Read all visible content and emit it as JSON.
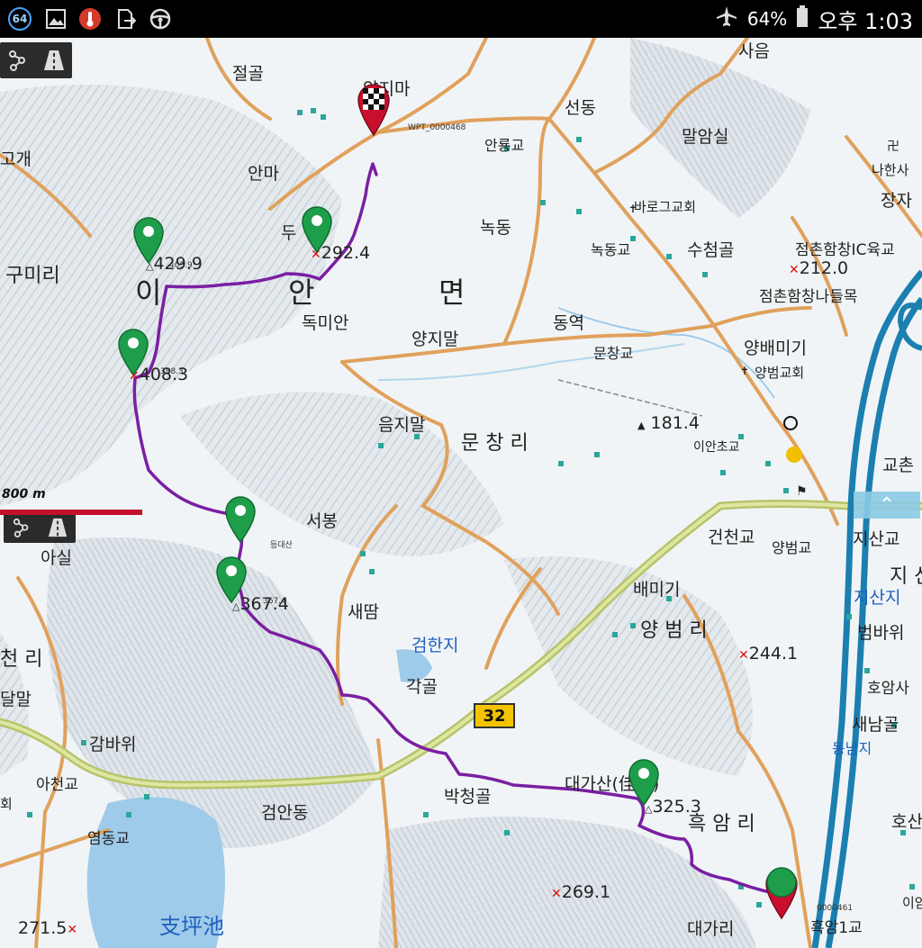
{
  "status_bar": {
    "notification_badge": "64",
    "battery_text": "64%",
    "clock": "오후 1:03",
    "icons": [
      "notification-64-icon",
      "image-icon",
      "thermometer-icon",
      "file-share-icon",
      "steering-wheel-icon",
      "airplane-mode-icon",
      "battery-icon"
    ]
  },
  "map_controls": {
    "top": [
      "route-nodes-icon",
      "road-icon"
    ],
    "bottom": [
      "route-nodes-icon",
      "road-icon"
    ]
  },
  "scale": {
    "label": "800 m"
  },
  "route_number": "32",
  "place_labels": {
    "jeolgol": "절골",
    "yangjima": "양지마",
    "sameum": "사음",
    "seondong": "선동",
    "malamsil": "말암실",
    "anryonggyo": "안룡교",
    "goge": "고개",
    "anma": "안마",
    "nokdong": "녹동",
    "barogeu_church": "바로그교회",
    "naham_church": "나한사",
    "jangja": "장자",
    "duryeong": "두",
    "nokdonggyo": "녹동교",
    "suchamgol": "수첨골",
    "jeomchon_ic": "점촌함창IC육교",
    "gumiri": "구미리",
    "jeomchon_bridge": "점촌함창나들목",
    "dongnian": "독미안",
    "dongyeok": "동역",
    "yangjimal": "양지말",
    "yangbaemigi": "양배미기",
    "munchanggyo": "문창교",
    "yangbeom_church": "양범교회",
    "eumjimal": "음지말",
    "munchangri": "문 창 리",
    "ianchogyo": "이안초교",
    "gyochon": "교촌",
    "seobong": "서봉",
    "geonchongyo": "건천교",
    "yangbeomgyo": "양범교",
    "jisangyo": "지산교",
    "asil": "아실",
    "deungdaesan": "등대산",
    "jisan": "지 산",
    "jisanji": "지산지",
    "baemigi": "배미기",
    "yangbeomri": "양 범 리",
    "saeddam": "새땀",
    "beombawi": "범바위",
    "cheonri": "천 리",
    "geomhanji": "검한지",
    "gakgol": "각골",
    "hoamsa": "호암사",
    "dalmal": "달말",
    "saenamgol": "새남골",
    "gambawi": "감바위",
    "dongnamji": "동남지",
    "achongyo": "아천교",
    "daegasan": "대가산(佳山)",
    "hoe": "회",
    "bakcheonggol": "박청골",
    "geomandong": "검안동",
    "heugamri": "흑 암 리",
    "hosan": "호산",
    "yeomdonggyo": "염동교",
    "gapyeongji": "支坪池",
    "daegari": "대가리",
    "heugam1gyo": "흑암1교",
    "igyo": "이암",
    "i_myeon_i": "이",
    "i_myeon_an": "안",
    "i_myeon_myeon": "면"
  },
  "elevations": {
    "e429": "429.9",
    "e292": "292.4",
    "e212": "212.0",
    "e408": "408.3",
    "e181": "181.4",
    "e367": "367.4",
    "e244": "244.1",
    "e325": "325.3",
    "e269": "269.1",
    "e271": "271.5"
  },
  "waypoint_labels": {
    "wpt_top": "WPT_0000468",
    "wpt_bottom": "0000461",
    "small_a": "405.9",
    "small_b": "388.3",
    "small_c": "367.4"
  },
  "colors": {
    "route": "#7a1fa2",
    "main_road": "#c8d27a",
    "road": "#e0a15c",
    "expressway": "#1b7fb0",
    "marker_green": "#1e9e4a",
    "marker_red": "#c8102e",
    "water": "#9ecbea"
  }
}
